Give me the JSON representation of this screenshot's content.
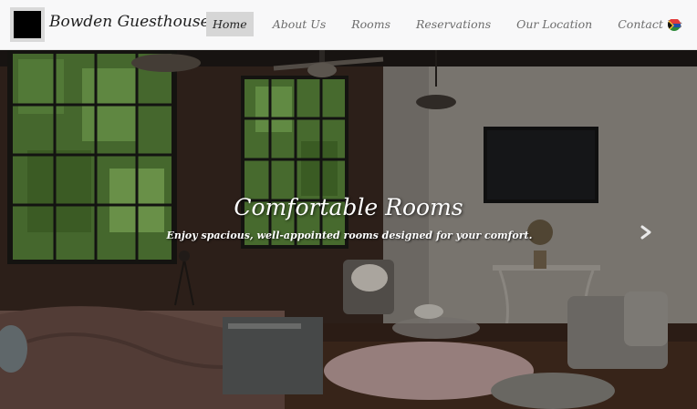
{
  "brand": {
    "name": "Bowden Guesthouse",
    "logo_icon": "square-logo-icon"
  },
  "nav": {
    "items": [
      {
        "label": "Home",
        "active": true
      },
      {
        "label": "About Us",
        "active": false
      },
      {
        "label": "Rooms",
        "active": false
      },
      {
        "label": "Reservations",
        "active": false
      },
      {
        "label": "Our Location",
        "active": false
      },
      {
        "label": "Contact Us",
        "active": false
      }
    ],
    "language_icon": "flag-icon"
  },
  "hero": {
    "title": "Comfortable Rooms",
    "subtitle": "Enjoy spacious, well-appointed rooms designed for your comfort.",
    "next_icon": "chevron-right-icon"
  },
  "colors": {
    "navbar_bg": "#f8f8f9",
    "active_bg": "#d6d6d6",
    "nav_text": "#6c6c6c",
    "hero_text": "#ffffff"
  }
}
